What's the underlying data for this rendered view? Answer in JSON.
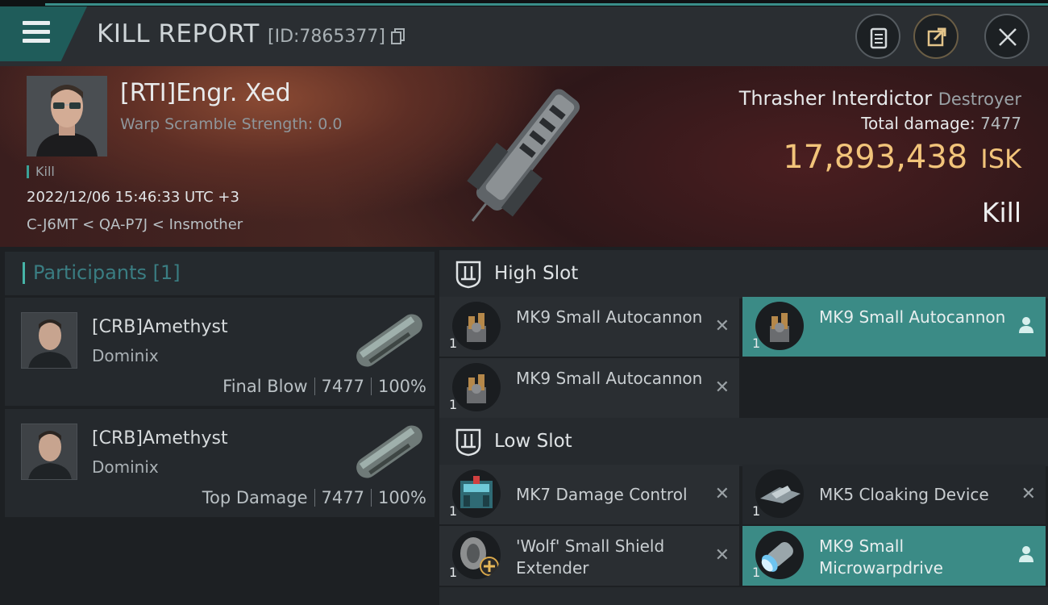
{
  "header": {
    "title": "KILL REPORT",
    "report_id": "[ID:7865377]"
  },
  "victim": {
    "name": "[RTI]Engr. Xed",
    "warp_scramble": "Warp Scramble Strength: 0.0",
    "kill_tag": "Kill",
    "datetime": "2022/12/06 15:46:33 UTC +3",
    "location": "C-J6MT < QA-P7J < Insmother",
    "ship_name": "Thrasher Interdictor",
    "ship_class": "Destroyer",
    "total_damage_label": "Total damage:",
    "total_damage": "7477",
    "isk_value": "17,893,438",
    "isk_unit": "ISK",
    "result": "Kill"
  },
  "participants": {
    "header": "Participants [1]",
    "rows": [
      {
        "name": "[CRB]Amethyst",
        "ship": "Dominix",
        "role": "Final Blow",
        "damage": "7477",
        "percent": "100%"
      },
      {
        "name": "[CRB]Amethyst",
        "ship": "Dominix",
        "role": "Top Damage",
        "damage": "7477",
        "percent": "100%"
      }
    ]
  },
  "slots": {
    "high": {
      "label": "High Slot",
      "modules": [
        {
          "qty": "1",
          "name": "MK9 Small Autocannon",
          "state": "destroyed",
          "icon": "autocannon-icon"
        },
        {
          "qty": "1",
          "name": "MK9 Small Autocannon",
          "state": "dropped",
          "icon": "autocannon-icon"
        },
        {
          "qty": "1",
          "name": "MK9 Small Autocannon",
          "state": "destroyed",
          "icon": "autocannon-icon"
        }
      ]
    },
    "low": {
      "label": "Low Slot",
      "modules": [
        {
          "qty": "1",
          "name": "MK7 Damage Control",
          "state": "destroyed",
          "icon": "damage-control-icon"
        },
        {
          "qty": "1",
          "name": "MK5 Cloaking Device",
          "state": "destroyed",
          "icon": "cloaking-device-icon"
        },
        {
          "qty": "1",
          "name": "'Wolf' Small Shield Extender",
          "state": "destroyed",
          "icon": "shield-extender-icon"
        },
        {
          "qty": "1",
          "name": "MK9 Small Microwarpdrive",
          "state": "dropped",
          "icon": "microwarpdrive-icon"
        }
      ]
    }
  },
  "colors": {
    "accent": "#3b8b86",
    "isk": "#f2c47a"
  }
}
